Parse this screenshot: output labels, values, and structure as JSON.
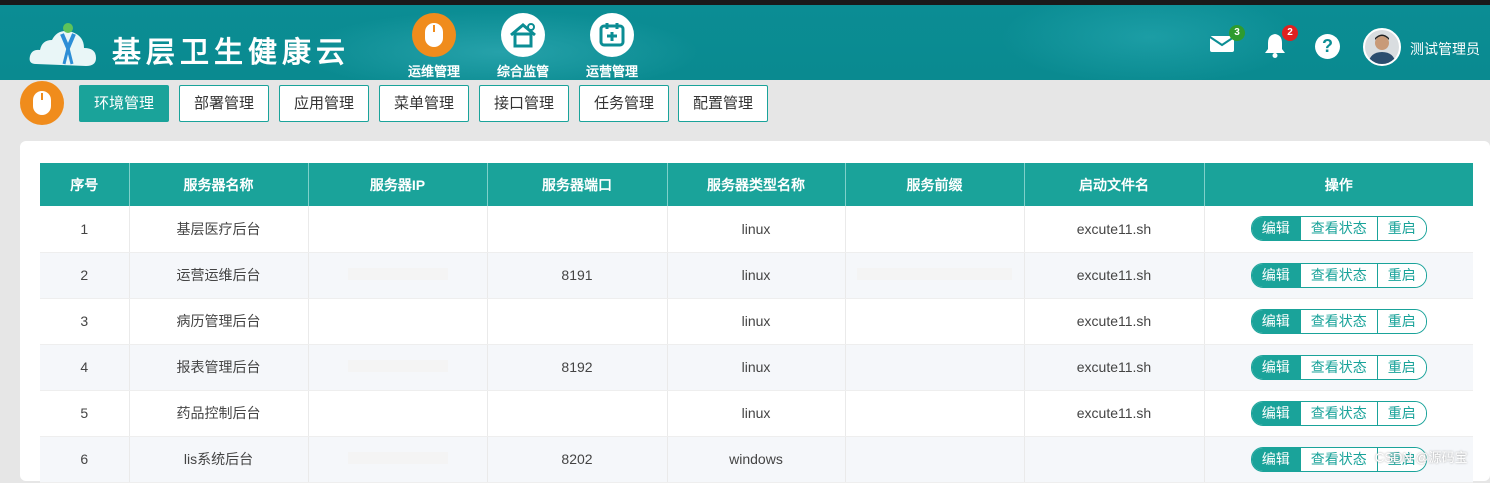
{
  "header": {
    "app_title": "基层卫生健康云",
    "modules": [
      {
        "label": "运维管理",
        "icon": "mouse-icon",
        "active": true
      },
      {
        "label": "综合监管",
        "icon": "home-settings-icon",
        "active": false
      },
      {
        "label": "运营管理",
        "icon": "calendar-plus-icon",
        "active": false
      }
    ],
    "mail_count": "3",
    "notice_count": "2",
    "help_label": "?",
    "user_name": "测试管理员"
  },
  "tabs": [
    "环境管理",
    "部署管理",
    "应用管理",
    "菜单管理",
    "接口管理",
    "任务管理",
    "配置管理"
  ],
  "table": {
    "columns": [
      "序号",
      "服务器名称",
      "服务器IP",
      "服务器端口",
      "服务器类型名称",
      "服务前缀",
      "启动文件名",
      "操作"
    ],
    "rows": [
      {
        "no": "1",
        "name": "基层医疗后台",
        "ip": "",
        "port": "",
        "type": "linux",
        "prefix": "",
        "file": "excute11.sh"
      },
      {
        "no": "2",
        "name": "运营运维后台",
        "ip": "",
        "port": "8191",
        "type": "linux",
        "prefix": "",
        "file": "excute11.sh"
      },
      {
        "no": "3",
        "name": "病历管理后台",
        "ip": "",
        "port": "",
        "type": "linux",
        "prefix": "",
        "file": "excute11.sh"
      },
      {
        "no": "4",
        "name": "报表管理后台",
        "ip": "",
        "port": "8192",
        "type": "linux",
        "prefix": "",
        "file": "excute11.sh"
      },
      {
        "no": "5",
        "name": "药品控制后台",
        "ip": "",
        "port": "",
        "type": "linux",
        "prefix": "",
        "file": "excute11.sh"
      },
      {
        "no": "6",
        "name": "lis系统后台",
        "ip": "",
        "port": "8202",
        "type": "windows",
        "prefix": "",
        "file": ""
      }
    ],
    "actions": {
      "edit": "编辑",
      "status": "查看状态",
      "restart": "重启"
    }
  },
  "watermark": "CSDN @源码宝",
  "colors": {
    "teal": "#1aa39a",
    "orange": "#f08c1c",
    "header": "#0b8d94",
    "badge_green": "#2e9b2e",
    "badge_red": "#e02020"
  }
}
